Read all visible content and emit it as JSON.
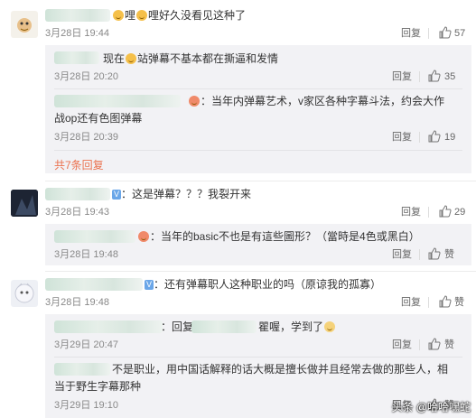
{
  "comments": [
    {
      "text_prefix": "",
      "text": "哩好久没看见这种了",
      "emoji_lead": "哩",
      "time": "3月28日 19:44",
      "reply_label": "回复",
      "likes": "57",
      "sub_replies": [
        {
          "text": "站弹幕不基本都在撕逼和发情",
          "text_prefix": "现在",
          "time": "3月28日 20:20",
          "reply_label": "回复",
          "likes": "35"
        },
        {
          "text": "：当年内弹幕艺术，v家区各种字幕斗法，约会大作",
          "text_line2": "战op还有色图弹幕",
          "time": "3月28日 20:39",
          "reply_label": "回复",
          "likes": "19"
        }
      ],
      "more_replies": "共7条回复"
    },
    {
      "text": "：这是弹幕？？？我裂开来",
      "time": "3月28日 19:43",
      "reply_label": "回复",
      "likes": "29",
      "sub_replies": [
        {
          "text": "：当年的basic不也是有這些圖形？（當時是4色或黑白）",
          "time": "3月28日 19:48",
          "reply_label": "回复",
          "likes": "赞"
        }
      ]
    },
    {
      "text": "：还有弹幕职人这种职业的吗（原谅我的孤寡）",
      "time": "3月28日 19:48",
      "reply_label": "回复",
      "likes": "赞",
      "sub_replies": [
        {
          "text": "：回复",
          "text_suffix": "瞿喔，学到了",
          "time": "3月29日 20:47",
          "reply_label": "回复",
          "likes": "赞"
        },
        {
          "text": "不是职业，用中国话解释的话大概是擅长做并且经常去做的那些人，相",
          "text_line2": "当于野生字幕那种",
          "time": "3月29日 19:10",
          "reply_label": "回复",
          "likes": "赞"
        }
      ]
    }
  ],
  "watermark": "头条 @哈哈嘿蛇",
  "colors": {
    "accent": "#eb7350",
    "reply_bg": "#f2f2f5",
    "meta": "#888888"
  }
}
